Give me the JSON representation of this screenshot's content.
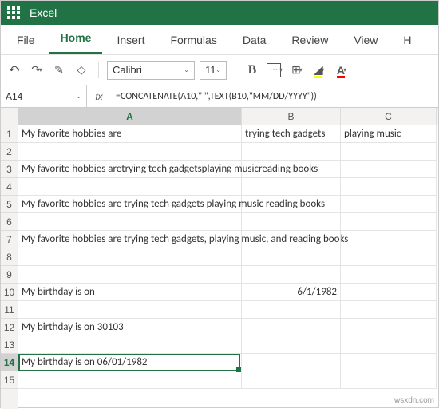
{
  "app": {
    "name": "Excel"
  },
  "menu": {
    "items": [
      "File",
      "Home",
      "Insert",
      "Formulas",
      "Data",
      "Review",
      "View",
      "H"
    ],
    "active_index": 1
  },
  "toolbar": {
    "undo": "↶",
    "redo": "↷",
    "paint": "✎",
    "clear": "◇",
    "font_name": "Calibri",
    "font_size": "11",
    "bold": "B",
    "borders": "⊞",
    "fill": "🪣",
    "textcolor": "A"
  },
  "ref": {
    "cell": "A14",
    "formula": "=CONCATENATE(A10,\" \",TEXT(B10,\"MM/DD/YYYY\"))"
  },
  "columns": [
    "A",
    "B",
    "C"
  ],
  "rows": {
    "1": {
      "A": "My favorite hobbies are",
      "B": "trying tech gadgets",
      "C": "playing music"
    },
    "2": {
      "A": "",
      "B": "",
      "C": ""
    },
    "3": {
      "A": "My favorite hobbies aretrying tech gadgetsplaying musicreading books",
      "B": "",
      "C": ""
    },
    "4": {
      "A": "",
      "B": "",
      "C": ""
    },
    "5": {
      "A": "My favorite hobbies are trying tech gadgets playing music reading books",
      "B": "",
      "C": ""
    },
    "6": {
      "A": "",
      "B": "",
      "C": ""
    },
    "7": {
      "A": "My favorite hobbies are trying tech gadgets, playing music, and reading books",
      "B": "",
      "C": ""
    },
    "8": {
      "A": "",
      "B": "",
      "C": ""
    },
    "9": {
      "A": "",
      "B": "",
      "C": ""
    },
    "10": {
      "A": "My birthday is on",
      "B": "6/1/1982",
      "C": ""
    },
    "11": {
      "A": "",
      "B": "",
      "C": ""
    },
    "12": {
      "A": "My birthday is on 30103",
      "B": "",
      "C": ""
    },
    "13": {
      "A": "",
      "B": "",
      "C": ""
    },
    "14": {
      "A": "My birthday is on 06/01/1982",
      "B": "",
      "C": ""
    },
    "15": {
      "A": "",
      "B": "",
      "C": ""
    }
  },
  "selection": {
    "row": 14,
    "col": "A"
  },
  "watermark": "wsxdn.com"
}
